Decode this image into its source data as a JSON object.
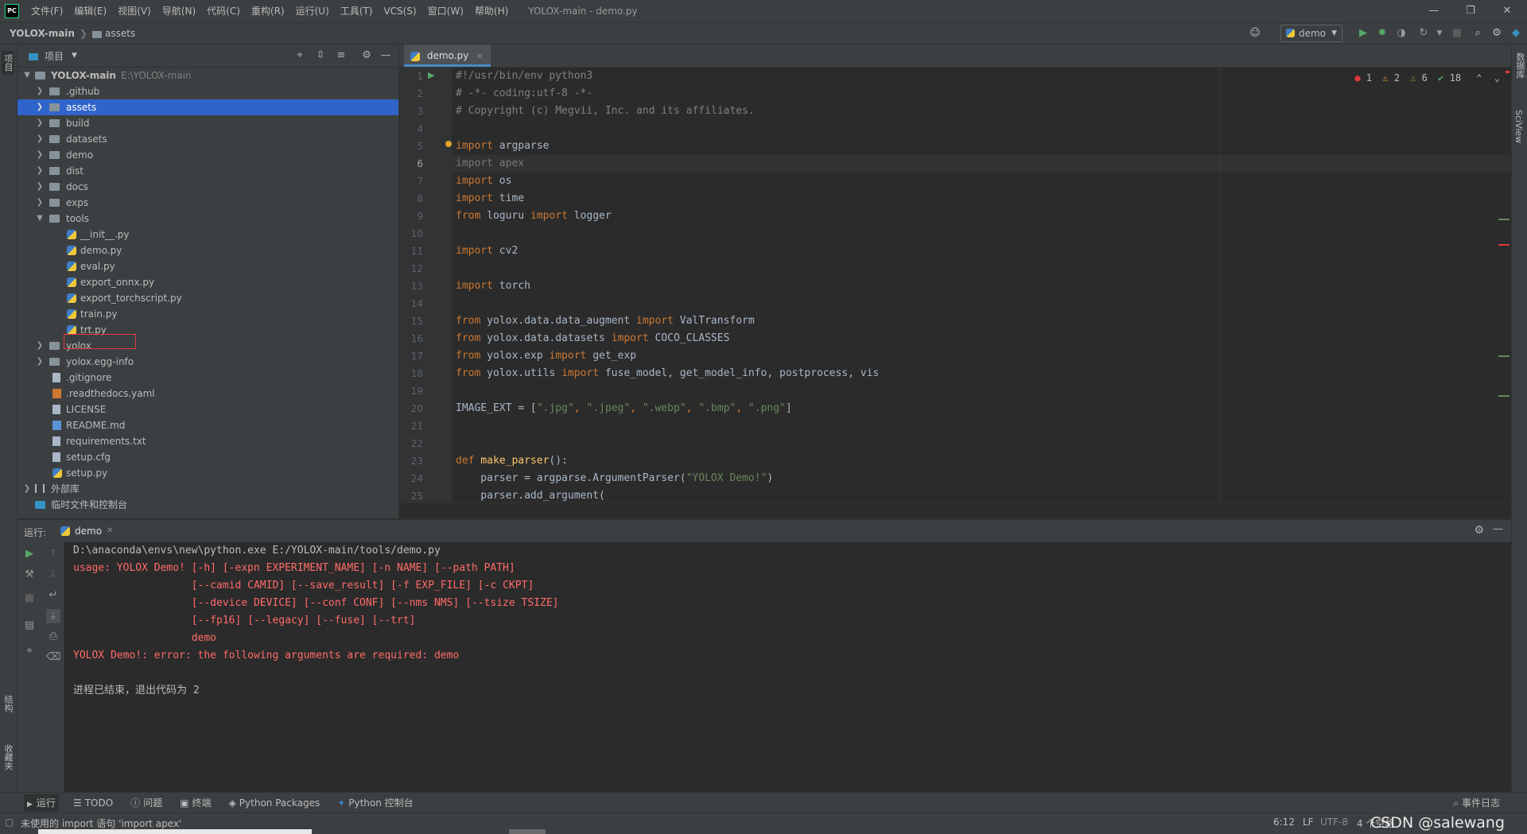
{
  "titlebar": {
    "menus": [
      "文件(F)",
      "编辑(E)",
      "视图(V)",
      "导航(N)",
      "代码(C)",
      "重构(R)",
      "运行(U)",
      "工具(T)",
      "VCS(S)",
      "窗口(W)",
      "帮助(H)"
    ],
    "window_title": "YOLOX-main - demo.py",
    "logo_text": "PC"
  },
  "navbar": {
    "project": "YOLOX-main",
    "folder": "assets",
    "run_config": "demo"
  },
  "left_stripe": {
    "project_label": "项目",
    "structure_label": "结构",
    "favorites_label": "收藏夹"
  },
  "right_stripe": {
    "database_label": "数据库",
    "sciview_label": "SciView"
  },
  "project_panel": {
    "title": "项目",
    "root": {
      "name": "YOLOX-main",
      "path": "E:\\YOLOX-main"
    },
    "items": [
      {
        "name": ".github",
        "kind": "folder"
      },
      {
        "name": "assets",
        "kind": "folder"
      },
      {
        "name": "build",
        "kind": "folder"
      },
      {
        "name": "datasets",
        "kind": "folder"
      },
      {
        "name": "demo",
        "kind": "folder"
      },
      {
        "name": "dist",
        "kind": "folder"
      },
      {
        "name": "docs",
        "kind": "folder"
      },
      {
        "name": "exps",
        "kind": "folder"
      },
      {
        "name": "tools",
        "kind": "folder"
      }
    ],
    "tools_children": [
      "__init__.py",
      "demo.py",
      "eval.py",
      "export_onnx.py",
      "export_torchscript.py",
      "train.py",
      "trt.py"
    ],
    "after_items": [
      {
        "name": "yolox",
        "kind": "folder"
      },
      {
        "name": "yolox.egg-info",
        "kind": "folder"
      }
    ],
    "files": [
      {
        "name": ".gitignore",
        "kind": "file"
      },
      {
        "name": ".readthedocs.yaml",
        "kind": "yaml"
      },
      {
        "name": "LICENSE",
        "kind": "file"
      },
      {
        "name": "README.md",
        "kind": "md"
      },
      {
        "name": "requirements.txt",
        "kind": "file"
      },
      {
        "name": "setup.cfg",
        "kind": "file"
      },
      {
        "name": "setup.py",
        "kind": "py"
      }
    ],
    "external_libs": "外部库",
    "scratches": "临时文件和控制台"
  },
  "editor": {
    "tab": "demo.py",
    "inspection": {
      "errors": "1",
      "warnings": "2",
      "weak_warnings": "6",
      "ok": "18"
    },
    "line_numbers": [
      "1",
      "2",
      "3",
      "4",
      "5",
      "6",
      "7",
      "8",
      "9",
      "10",
      "11",
      "12",
      "13",
      "14",
      "15",
      "16",
      "17",
      "18",
      "19",
      "20",
      "21",
      "22",
      "23",
      "24",
      "25"
    ],
    "code": {
      "l1": "#!/usr/bin/env python3",
      "l2": "# -*- coding:utf-8 -*-",
      "l3": "# Copyright (c) Megvii, Inc. and its affiliates.",
      "l5_kw": "import",
      "l5_rest": " argparse",
      "l6_kw": "import",
      "l6_rest": " apex",
      "l7_kw": "import",
      "l7_rest": " os",
      "l8_kw": "import",
      "l8_rest": " time",
      "l9_kw1": "from",
      "l9_mid": " loguru ",
      "l9_kw2": "import",
      "l9_rest": " logger",
      "l11_kw": "import",
      "l11_rest": " cv2",
      "l13_kw": "import",
      "l13_rest": " torch",
      "l15_kw1": "from",
      "l15_mid": " yolox.data.data_augment ",
      "l15_kw2": "import",
      "l15_rest": " ValTransform",
      "l16_kw1": "from",
      "l16_mid": " yolox.data.datasets ",
      "l16_kw2": "import",
      "l16_rest": " COCO_CLASSES",
      "l17_kw1": "from",
      "l17_mid": " yolox.exp ",
      "l17_kw2": "import",
      "l17_rest": " get_exp",
      "l18_kw1": "from",
      "l18_mid": " yolox.utils ",
      "l18_kw2": "import",
      "l18_rest": " fuse_model, get_model_info, postprocess, vis",
      "l20_a": "IMAGE_EXT = [",
      "l20_s1": "\".jpg\"",
      "l20_c1": ", ",
      "l20_s2": "\".jpeg\"",
      "l20_c2": ", ",
      "l20_s3": "\".webp\"",
      "l20_c3": ", ",
      "l20_s4": "\".bmp\"",
      "l20_c4": ", ",
      "l20_s5": "\".png\"",
      "l20_end": "]",
      "l23_kw": "def",
      "l23_fn": " make_parser",
      "l23_rest": "():",
      "l24_a": "    parser = argparse.ArgumentParser(",
      "l24_s": "\"YOLOX Demo!\"",
      "l24_end": ")",
      "l25": "    parser.add_argument("
    }
  },
  "run_panel": {
    "label": "运行:",
    "tab": "demo",
    "output": {
      "cmd": "D:\\anaconda\\envs\\new\\python.exe E:/YOLOX-main/tools/demo.py",
      "err1": "usage: YOLOX Demo! [-h] [-expn EXPERIMENT_NAME] [-n NAME] [--path PATH]",
      "err2": "                   [--camid CAMID] [--save_result] [-f EXP_FILE] [-c CKPT]",
      "err3": "                   [--device DEVICE] [--conf CONF] [--nms NMS] [--tsize TSIZE]",
      "err4": "                   [--fp16] [--legacy] [--fuse] [--trt]",
      "err5": "                   demo",
      "err6": "YOLOX Demo!: error: the following arguments are required: demo",
      "exit": "进程已结束，退出代码为 2"
    }
  },
  "bottom_tools": [
    "运行",
    "TODO",
    "问题",
    "终端",
    "Python Packages",
    "Python 控制台"
  ],
  "event_log": "事件日志",
  "statusbar": {
    "message": "未使用的 import 语句 'import apex'",
    "position": "6:12",
    "line_sep": "LF",
    "encoding": "UTF-8",
    "indent": "4 个空格",
    "watermark": "CSDN @salewang"
  }
}
